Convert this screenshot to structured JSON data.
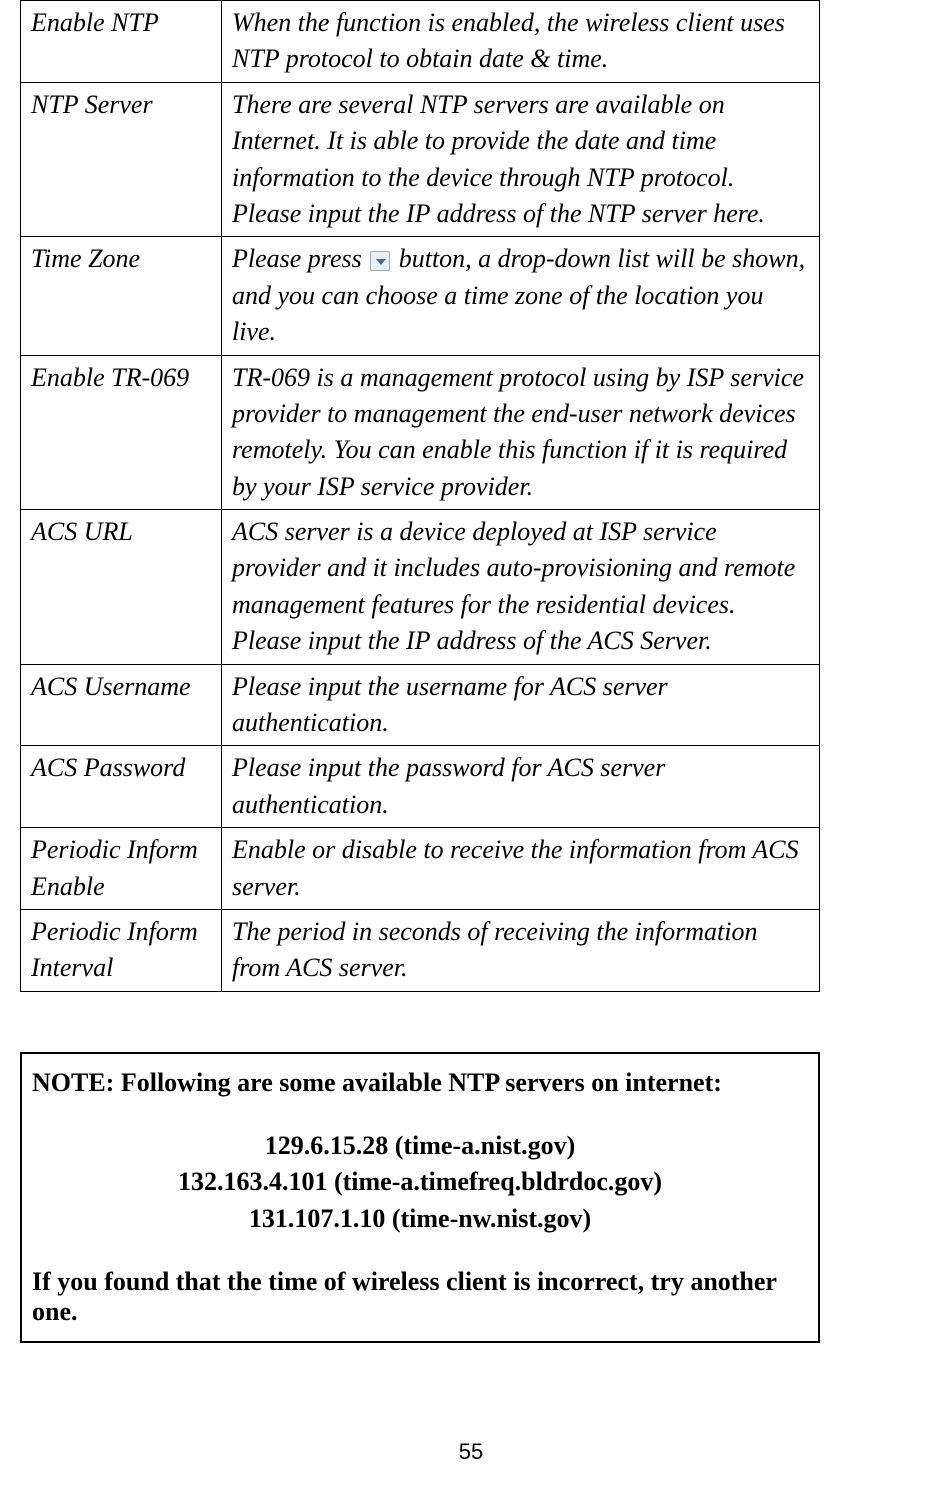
{
  "table": {
    "rows": [
      {
        "label": "Enable NTP",
        "desc": "When the function is enabled, the wireless client uses NTP protocol to obtain date & time."
      },
      {
        "label": "NTP Server",
        "desc": "There are several NTP servers are available on Internet. It is able to provide the date and time information to the device through NTP protocol. Please input the IP address of the NTP server here."
      },
      {
        "label": "Time Zone",
        "desc_before": "Please press ",
        "desc_after": " button, a drop-down list will be shown, and you can choose a time zone of the location you live."
      },
      {
        "label": "Enable TR-069",
        "desc": "TR-069 is a management protocol using by ISP service provider to management the end-user network devices remotely. You can enable this function if it is required by your ISP service provider."
      },
      {
        "label": "ACS URL",
        "desc": "ACS server is a device deployed at ISP service provider and it includes auto-provisioning and remote management features for the residential devices. Please input the IP address of the ACS Server."
      },
      {
        "label": "ACS Username",
        "desc": "Please input the username for ACS server authentication."
      },
      {
        "label": "ACS Password",
        "desc": "Please input the password for ACS server authentication."
      },
      {
        "label": "Periodic Inform Enable",
        "desc": "Enable or disable to receive the information from ACS server."
      },
      {
        "label": "Periodic Inform Interval",
        "desc": "The period in seconds of receiving the information from ACS server."
      }
    ]
  },
  "note": {
    "title": "NOTE: Following are some available NTP servers on internet:",
    "servers": [
      "129.6.15.28 (time-a.nist.gov)",
      "132.163.4.101 (time-a.timefreq.bldrdoc.gov)",
      "131.107.1.10 (time-nw.nist.gov)"
    ],
    "footer": "If you found that the time of wireless client is incorrect, try another one."
  },
  "page_number": "55"
}
